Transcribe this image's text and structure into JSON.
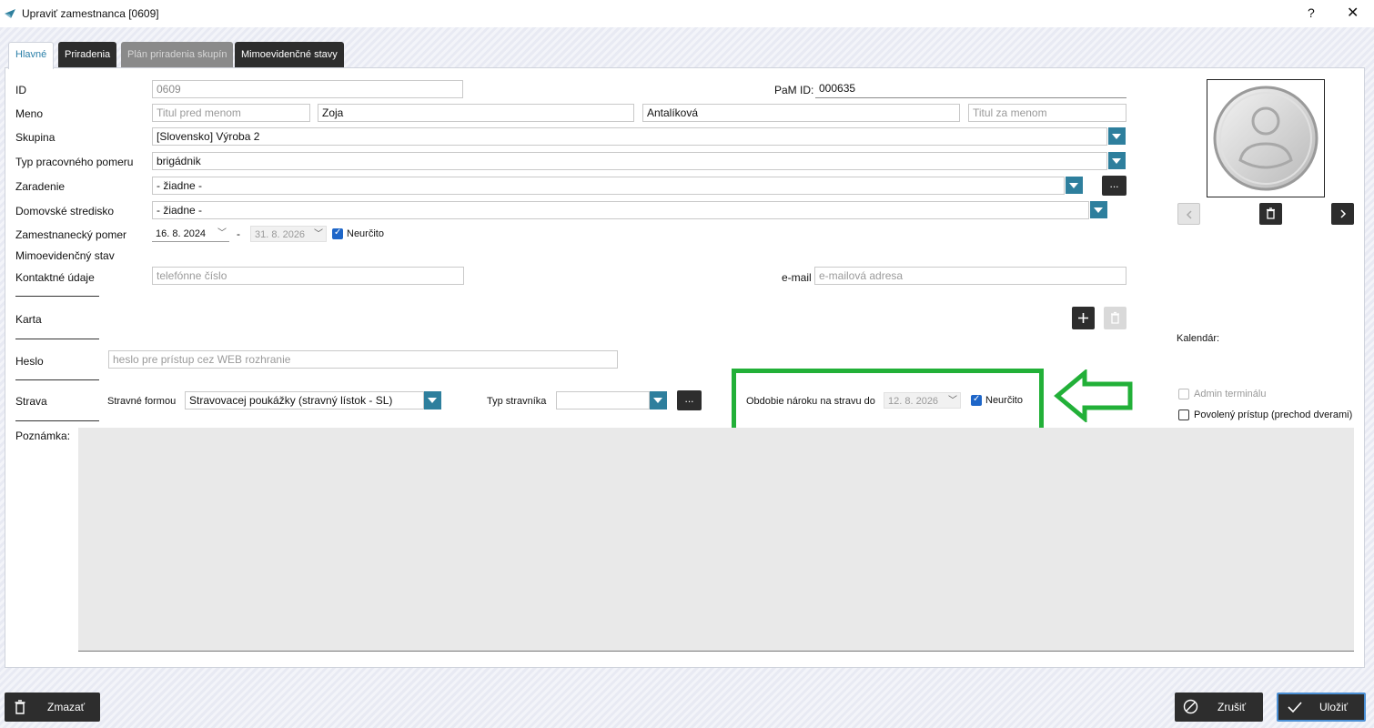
{
  "window": {
    "title": "Upraviť zamestnanca [0609]",
    "help": "?",
    "close": "✕"
  },
  "tabs": [
    {
      "label": "Hlavné",
      "state": "active"
    },
    {
      "label": "Priradenia",
      "state": "normal"
    },
    {
      "label": "Plán priradenia skupín",
      "state": "disabled"
    },
    {
      "label": "Mimoevidenčné stavy",
      "state": "normal"
    }
  ],
  "form": {
    "id_label": "ID",
    "id_value": "0609",
    "pam_label": "PaM ID:",
    "pam_value": "000635",
    "name_label": "Meno",
    "title_before_placeholder": "Titul pred menom",
    "first_name": "Zoja",
    "last_name": "Antalíková",
    "title_after_placeholder": "Titul za menom",
    "group_label": "Skupina",
    "group_value": "[Slovensko] Výroba 2",
    "employment_type_label": "Typ pracovného pomeru",
    "employment_type_value": "brigádnik",
    "category_label": "Zaradenie",
    "category_value": "- žiadne -",
    "home_center_label": "Domovské stredisko",
    "home_center_value": "- žiadne -",
    "employment_label": "Zamestnanecký pomer",
    "employment_from": "16. 8. 2024",
    "employment_dash": "-",
    "employment_to": "31. 8. 2026",
    "indefinite_label": "Neurčito",
    "off_record_label": "Mimoevidenčný stav",
    "contact_label": "Kontaktné údaje",
    "phone_placeholder": "telefónne číslo",
    "email_label": "e-mail",
    "email_placeholder": "e-mailová adresa",
    "card_label": "Karta",
    "password_label": "Heslo",
    "password_placeholder": "heslo pre prístup cez WEB rozhranie",
    "meal_label": "Strava",
    "meal_form_label": "Stravné formou",
    "meal_form_value": "Stravovacej poukážky (stravný lístok - SL)",
    "diner_type_label": "Typ stravníka",
    "diner_type_value": "",
    "meal_period_label": "Obdobie nároku na stravu do",
    "meal_period_date": "12. 8. 2026",
    "meal_indefinite_label": "Neurčito",
    "note_label": "Poznámka:",
    "dots": "..."
  },
  "side": {
    "calendar_label": "Kalendár:",
    "admin_terminal_label": "Admin terminálu",
    "allowed_access_label": "Povolený prístup (prechod dverami)"
  },
  "buttons": {
    "delete": "Zmazať",
    "cancel": "Zrušiť",
    "save": "Uložiť"
  },
  "colors": {
    "accent": "#2e7f9d",
    "highlight": "#22b038",
    "dark_button": "#2d2d2d",
    "checkbox": "#1e66c8"
  }
}
